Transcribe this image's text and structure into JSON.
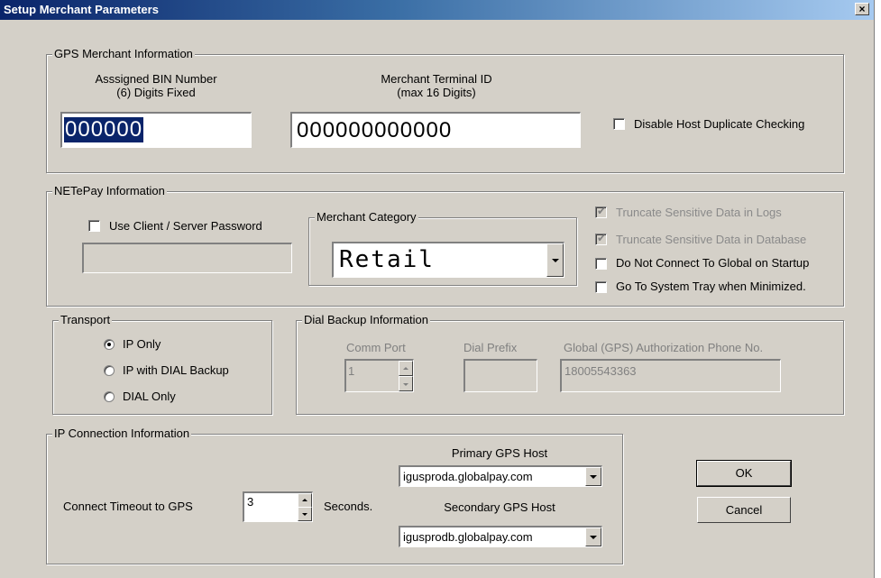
{
  "window": {
    "title": "Setup Merchant Parameters",
    "close_glyph": "×"
  },
  "gps_merchant": {
    "legend": "GPS Merchant Information",
    "bin_label_1": "Asssigned BIN Number",
    "bin_label_2": "(6) Digits Fixed",
    "bin_value": "000000",
    "terminal_label_1": "Merchant Terminal ID",
    "terminal_label_2": "(max 16 Digits)",
    "terminal_value": "000000000000",
    "disable_dup_label": "Disable Host Duplicate Checking",
    "disable_dup_checked": false
  },
  "netepay": {
    "legend": "NETePay Information",
    "client_server_label": "Use Client / Server Password",
    "client_server_checked": false,
    "password_value": "",
    "merchant_category_legend": "Merchant Category",
    "merchant_category_value": "Retail",
    "truncate_logs_label": "Truncate Sensitive Data in Logs",
    "truncate_logs_checked": true,
    "truncate_db_label": "Truncate Sensitive Data in Database",
    "truncate_db_checked": true,
    "no_connect_label": "Do Not Connect To Global on Startup",
    "no_connect_checked": false,
    "system_tray_label": "Go To System Tray when Minimized.",
    "system_tray_checked": false
  },
  "transport": {
    "legend": "Transport",
    "options": [
      "IP Only",
      "IP with DIAL Backup",
      "DIAL Only"
    ],
    "selected_index": 0
  },
  "dial_backup": {
    "legend": "Dial Backup Information",
    "comm_port_label": "Comm Port",
    "comm_port_value": "1",
    "dial_prefix_label": "Dial Prefix",
    "dial_prefix_value": "",
    "phone_label": "Global (GPS) Authorization Phone No.",
    "phone_value": "18005543363"
  },
  "ip_connection": {
    "legend": "IP Connection  Information",
    "timeout_label": "Connect Timeout to GPS",
    "timeout_value": "3",
    "seconds_label": "Seconds.",
    "primary_label": "Primary GPS Host",
    "primary_value": "igusproda.globalpay.com",
    "secondary_label": "Secondary GPS Host",
    "secondary_value": "igusprodb.globalpay.com"
  },
  "buttons": {
    "ok": "OK",
    "cancel": "Cancel"
  },
  "colors": {
    "dialog_bg": "#d4d0c8",
    "titlebar_start": "#0a246a",
    "titlebar_end": "#a6caf0",
    "selection": "#0a246a",
    "disabled_text": "#808080"
  }
}
